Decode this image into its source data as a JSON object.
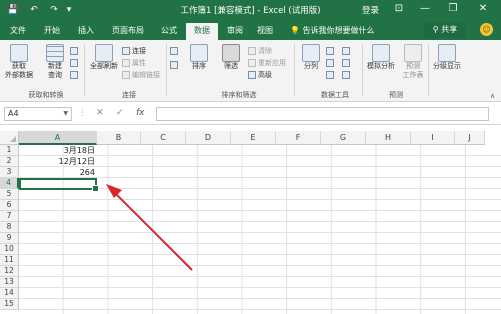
{
  "window": {
    "title": "工作簿1 [兼容模式] - Excel (试用版)",
    "login_label": "登录",
    "minimize": "—",
    "restore": "❐",
    "close": "✕",
    "save_icon": "💾",
    "undo_icon": "↶",
    "redo_icon": "↷",
    "customize_icon": "▾",
    "ribbon_display_icon": "⊡"
  },
  "tabs": [
    {
      "label": "文件"
    },
    {
      "label": "开始"
    },
    {
      "label": "插入"
    },
    {
      "label": "页面布局"
    },
    {
      "label": "公式"
    },
    {
      "label": "数据",
      "active": true
    },
    {
      "label": "审阅"
    },
    {
      "label": "视图"
    }
  ],
  "tell_me": "告诉我你想要做什么",
  "share_label": "共享",
  "smiley": "☺",
  "ribbon": {
    "get_external_data": "获取\n外部数据",
    "new_query": "新建\n查询",
    "refresh_all": "全部刷新",
    "connections": "连接",
    "properties": "属性",
    "edit_links": "编辑链接",
    "sort": "排序",
    "filter": "筛选",
    "clear": "清除",
    "reapply": "重新应用",
    "advanced": "高级",
    "text_to_columns": "分列",
    "what_if": "模拟分析",
    "forecast_sheet": "预测\n工作表",
    "outline": "分级显示",
    "groups": {
      "get_transform": "获取和转换",
      "connections": "连接",
      "sort_filter": "排序和筛选",
      "data_tools": "数据工具",
      "forecast": "预测"
    },
    "collapse": "∧"
  },
  "formula_bar": {
    "name_box": "A4",
    "cancel_icon": "✕",
    "enter_icon": "✓",
    "fx_label": "fx",
    "formula": ""
  },
  "columns": [
    "A",
    "B",
    "C",
    "D",
    "E",
    "F",
    "G",
    "H",
    "I",
    "J"
  ],
  "rows": [
    "1",
    "2",
    "3",
    "4",
    "5",
    "6",
    "7",
    "8",
    "9",
    "10",
    "11",
    "12",
    "13",
    "14",
    "15"
  ],
  "cells": {
    "A1": "3月18日",
    "A2": "12月12日",
    "A3": "264"
  },
  "colors": {
    "excel_green": "#217346",
    "annotation_arrow": "#d9262b"
  }
}
